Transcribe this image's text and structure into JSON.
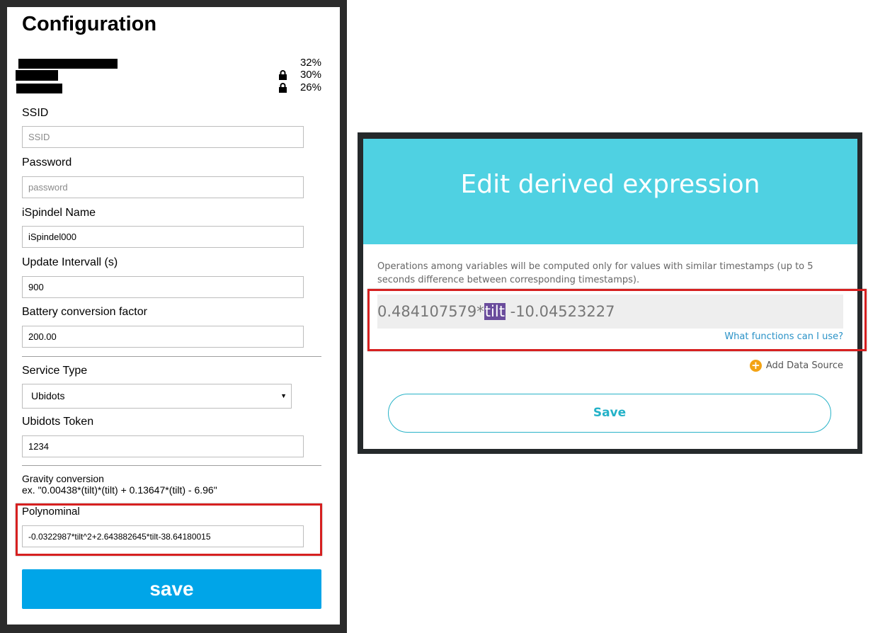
{
  "config_page": {
    "title": "Configuration",
    "networks": [
      {
        "signal": "32%",
        "locked": false
      },
      {
        "signal": "30%",
        "locked": true
      },
      {
        "signal": "26%",
        "locked": true
      }
    ],
    "fields": {
      "ssid": {
        "label": "SSID",
        "placeholder": "SSID",
        "value": ""
      },
      "password": {
        "label": "Password",
        "placeholder": "password",
        "value": ""
      },
      "name": {
        "label": "iSpindel Name",
        "value": "iSpindel000"
      },
      "interval": {
        "label": "Update Intervall (s)",
        "value": "900"
      },
      "battery": {
        "label": "Battery conversion factor",
        "value": "200.00"
      },
      "service_type": {
        "label": "Service Type",
        "value": "Ubidots"
      },
      "token": {
        "label": "Ubidots Token",
        "value": "1234"
      },
      "gravity": {
        "label": "Gravity conversion",
        "example": "ex. \"0.00438*(tilt)*(tilt) + 0.13647*(tilt) - 6.96\""
      },
      "polynomial": {
        "label": "Polynominal",
        "value": "-0.0322987*tilt^2+2.643882645*tilt-38.64180015"
      }
    },
    "save_label": "save"
  },
  "dialog": {
    "title": "Edit derived expression",
    "info": "Operations among variables will be computed only for values with similar timestamps (up to 5 seconds difference between corresponding timestamps).",
    "expression": {
      "prefix": "0.484107579*",
      "variable": "tilt",
      "suffix": " -10.04523227"
    },
    "functions_link": "What functions can I use?",
    "add_data_source": "Add Data Source",
    "save_label": "Save"
  },
  "colors": {
    "save_blue": "#00a5e8",
    "dialog_header": "#4fd1e2",
    "highlight_red": "#d62020",
    "variable_purple": "#6a4c9c",
    "add_source_orange": "#f3a314"
  },
  "icons": [
    "lock-icon",
    "plus-circle-icon",
    "chevron-down-icon"
  ]
}
